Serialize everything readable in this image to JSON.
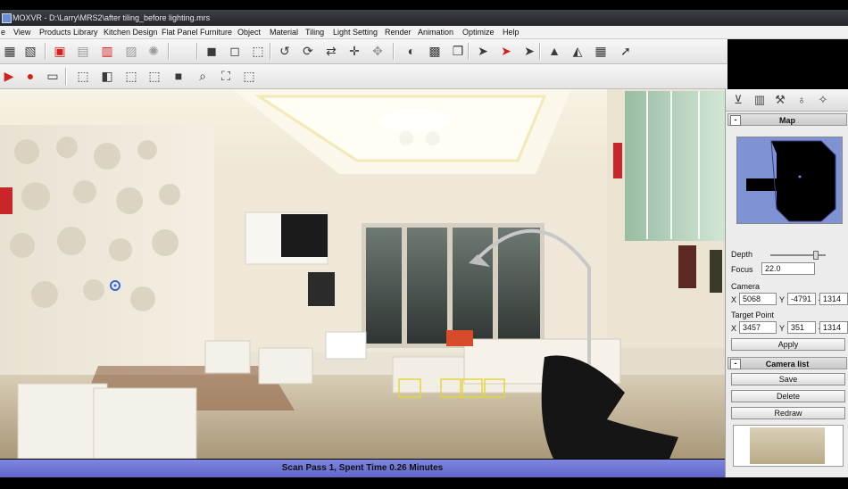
{
  "window": {
    "title": "MOXVR - D:\\Larry\\MRS2\\after tiling_before lighting.mrs"
  },
  "menu": {
    "items": [
      {
        "id": "file",
        "label": "e"
      },
      {
        "id": "view",
        "label": "View"
      },
      {
        "id": "products-library",
        "label": "Products Library"
      },
      {
        "id": "kitchen-design",
        "label": "Kitchen Design"
      },
      {
        "id": "flat-panel-furniture",
        "label": "Flat Panel Furniture"
      },
      {
        "id": "object",
        "label": "Object"
      },
      {
        "id": "material",
        "label": "Material"
      },
      {
        "id": "tiling",
        "label": "Tiling"
      },
      {
        "id": "light-setting",
        "label": "Light Setting"
      },
      {
        "id": "render",
        "label": "Render"
      },
      {
        "id": "animation",
        "label": "Animation"
      },
      {
        "id": "optimize",
        "label": "Optimize"
      },
      {
        "id": "help",
        "label": "Help"
      }
    ]
  },
  "toolbar1": {
    "buttons": [
      {
        "icon": "select-icon",
        "glyph": "▦",
        "tone": ""
      },
      {
        "icon": "group-icon",
        "glyph": "▧",
        "tone": ""
      },
      {
        "icon": "delete-object-icon",
        "glyph": "▣",
        "tone": "red"
      },
      {
        "icon": "move-object-icon",
        "glyph": "▤",
        "tone": "grey"
      },
      {
        "icon": "remove-object-icon",
        "glyph": "▥",
        "tone": "red"
      },
      {
        "icon": "copy-object-icon",
        "glyph": "▨",
        "tone": "grey"
      },
      {
        "icon": "light-burst-icon",
        "glyph": "✺",
        "tone": "grey"
      },
      {
        "icon": "cube-shaded-icon",
        "glyph": "◼",
        "tone": ""
      },
      {
        "icon": "cube-front-icon",
        "glyph": "◻",
        "tone": ""
      },
      {
        "icon": "cube-wire-icon",
        "glyph": "⬚",
        "tone": ""
      },
      {
        "icon": "rotate-left-icon",
        "glyph": "↺",
        "tone": ""
      },
      {
        "icon": "rotate-orbit-icon",
        "glyph": "⟳",
        "tone": ""
      },
      {
        "icon": "swap-icon",
        "glyph": "⇄",
        "tone": ""
      },
      {
        "icon": "move-cross-icon",
        "glyph": "✛",
        "tone": ""
      },
      {
        "icon": "snap-icon",
        "glyph": "✥",
        "tone": "grey"
      },
      {
        "icon": "paint-bucket-icon",
        "glyph": "◐",
        "tone": ""
      },
      {
        "icon": "material-box-icon",
        "glyph": "▩",
        "tone": ""
      },
      {
        "icon": "document-icon",
        "glyph": "❐",
        "tone": ""
      },
      {
        "icon": "pointer-icon",
        "glyph": "➤",
        "tone": ""
      },
      {
        "icon": "pointer-x-icon",
        "glyph": "➤",
        "tone": "red"
      },
      {
        "icon": "pointer-select-icon",
        "glyph": "➤",
        "tone": ""
      },
      {
        "icon": "roof-icon",
        "glyph": "▲",
        "tone": ""
      },
      {
        "icon": "terrain-icon",
        "glyph": "◭",
        "tone": ""
      },
      {
        "icon": "texture-icon",
        "glyph": "▦",
        "tone": ""
      },
      {
        "icon": "pointer-arrow-icon",
        "glyph": "➚",
        "tone": ""
      }
    ]
  },
  "toolbar2": {
    "buttons": [
      {
        "icon": "play-icon",
        "glyph": "▶",
        "tone": "red"
      },
      {
        "icon": "record-icon",
        "glyph": "●",
        "tone": "red"
      },
      {
        "icon": "camera-icon",
        "glyph": "▭",
        "tone": ""
      },
      {
        "icon": "view-perspective-icon",
        "glyph": "⬚",
        "tone": ""
      },
      {
        "icon": "view-top-icon",
        "glyph": "◧",
        "tone": ""
      },
      {
        "icon": "view-front-icon",
        "glyph": "⬚",
        "tone": ""
      },
      {
        "icon": "view-side-icon",
        "glyph": "⬚",
        "tone": ""
      },
      {
        "icon": "view-solid-icon",
        "glyph": "■",
        "tone": ""
      },
      {
        "icon": "zoom-icon",
        "glyph": "⌕",
        "tone": ""
      },
      {
        "icon": "zoom-extents-icon",
        "glyph": "⛶",
        "tone": ""
      },
      {
        "icon": "view-box-icon",
        "glyph": "⬚",
        "tone": ""
      }
    ]
  },
  "status": {
    "text": "Scan Pass 1, Spent Time 0.26 Minutes"
  },
  "panel": {
    "tabs": [
      {
        "icon": "camera-tripod-icon",
        "glyph": "⊻"
      },
      {
        "icon": "object-icon",
        "glyph": "▥"
      },
      {
        "icon": "tools-icon",
        "glyph": "⚒"
      },
      {
        "icon": "light-bulb-icon",
        "glyph": "♁"
      },
      {
        "icon": "spotlight-icon",
        "glyph": "✧"
      }
    ],
    "map": {
      "header": "Map",
      "collapse": "-"
    },
    "depth_label": "Depth",
    "depth_level": 0.85,
    "focus_label": "Focus",
    "focus_value": "22.0",
    "camera_label": "Camera",
    "camera": {
      "x_label": "X",
      "x": "5068",
      "y_label": "Y",
      "y": "-4791",
      "z_label": "Z",
      "z": "1314"
    },
    "target_label": "Target Point",
    "target": {
      "x_label": "X",
      "x": "3457",
      "y_label": "Y",
      "y": "351",
      "z_label": "Z",
      "z": "1314"
    },
    "apply_label": "Apply",
    "camera_list": {
      "header": "Camera list",
      "collapse": "-",
      "save_label": "Save",
      "delete_label": "Delete",
      "redraw_label": "Redraw"
    }
  },
  "colors": {
    "status_bar": "#6b72d4",
    "map_background": "#7f93d4",
    "title_bar": "#2f3236"
  }
}
